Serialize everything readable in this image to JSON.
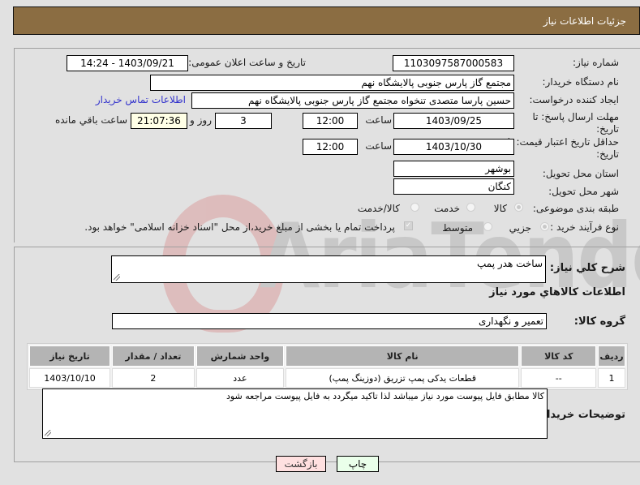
{
  "header": {
    "title": "جزئیات اطلاعات نیاز"
  },
  "form": {
    "need_number": {
      "label": "شماره نیاز:",
      "value": "1103097587000583"
    },
    "announce_datetime": {
      "label": "تاریخ و ساعت اعلان عمومی:",
      "value": "1403/09/21 - 14:24"
    },
    "buyer_org": {
      "label": "نام دستگاه خریدار:",
      "value": "مجتمع گاز پارس جنوبی  پالایشگاه نهم"
    },
    "requester": {
      "label": "ایجاد کننده درخواست:",
      "value": "حسین پارسا متصدی تنخواه مجتمع گاز پارس جنوبی  پالایشگاه نهم"
    },
    "buyer_contact_link": "اطلاعات تماس خریدار",
    "response_deadline": {
      "label_line1": "مهلت ارسال پاسخ: تا",
      "label_line2": "تاریخ:",
      "date": "1403/09/25",
      "time_label": "ساعت",
      "time": "12:00",
      "days": "3",
      "days_label": "روز و",
      "remaining": "21:07:36",
      "remaining_label": "ساعت باقي مانده"
    },
    "price_validity": {
      "label_line1": "حداقل تاریخ اعتبار قیمت: تا",
      "label_line2": "تاریخ:",
      "date": "1403/10/30",
      "time_label": "ساعت",
      "time": "12:00"
    },
    "delivery_province": {
      "label": "استان محل تحویل:",
      "value": "بوشهر"
    },
    "delivery_city": {
      "label": "شهر محل تحویل:",
      "value": "کنگان"
    },
    "category": {
      "label": "طبقه بندی موضوعی:",
      "options": [
        "کالا",
        "خدمت",
        "کالا/خدمت"
      ],
      "selected": "کالا"
    },
    "purchase_type": {
      "label": "نوع فرآیند خرید :",
      "options": [
        "جزیي",
        "متوسط"
      ],
      "selected": "جزیي",
      "treasury_note": "پرداخت تمام یا بخشی از مبلغ خرید،از محل \"اسناد خزانه اسلامی\" خواهد بود."
    }
  },
  "details": {
    "general_desc": {
      "label": "شرح کلي نیاز:",
      "value": "ساخت هدر پمپ"
    },
    "items_heading": "اطلاعات کالاهاي مورد نیاز",
    "goods_group": {
      "label": "گروه کالا:",
      "value": "تعمیر و نگهداری"
    },
    "table": {
      "columns": [
        "ردیف",
        "کد کالا",
        "نام کالا",
        "واحد شمارش",
        "تعداد / مقدار",
        "تاریخ نیاز"
      ],
      "rows": [
        [
          "1",
          "--",
          "قطعات یدکی پمپ تزریق (دوزینگ پمپ)",
          "عدد",
          "2",
          "1403/10/10"
        ]
      ]
    },
    "buyer_notes": {
      "label": "توضیحات خریدار:",
      "value": "کالا مطابق فایل پیوست مورد نیاز میباشد لذا تاکید میگردد به فایل پیوست مراجعه شود"
    }
  },
  "buttons": {
    "print": "چاپ",
    "back": "بازگشت"
  },
  "colors": {
    "header_bg": "#8b6d42",
    "link": "#3333cc",
    "print_bg": "#eaffea",
    "back_bg": "#ffe0e0"
  }
}
